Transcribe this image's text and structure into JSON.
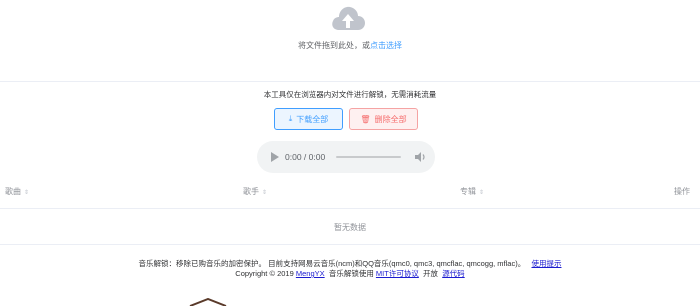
{
  "upload": {
    "icon": "cloud-upload-icon",
    "hint_text": "将文件拖到此处，或",
    "hint_link": "点击选择"
  },
  "notice": "本工具仅在浏览器内对文件进行解锁，无需消耗流量",
  "actions": {
    "download_all_label": "下载全部",
    "download_icon": "download-icon",
    "delete_all_label": "删除全部",
    "delete_icon": "trash-icon"
  },
  "player": {
    "time": "0:00 / 0:00"
  },
  "table": {
    "columns": [
      "歌曲",
      "歌手",
      "专辑",
      "操作"
    ],
    "empty_text": "暂无数据"
  },
  "footer": {
    "line1_text": "音乐解锁：移除已购音乐的加密保护。 目前支持网易云音乐(ncm)和QQ音乐(qmc0, qmc3, qmcflac, qmcogg, mflac)。",
    "usage_link": "使用提示",
    "copyright_prefix": "Copyright © 2019",
    "author": "MengYX",
    "middle_text": "音乐解锁使用",
    "license_link": "MIT许可协议",
    "open_text": "开放",
    "source_link": "源代码"
  },
  "colors": {
    "accent": "#409eff",
    "danger": "#f56c6c",
    "link": "#1c1cd0"
  }
}
